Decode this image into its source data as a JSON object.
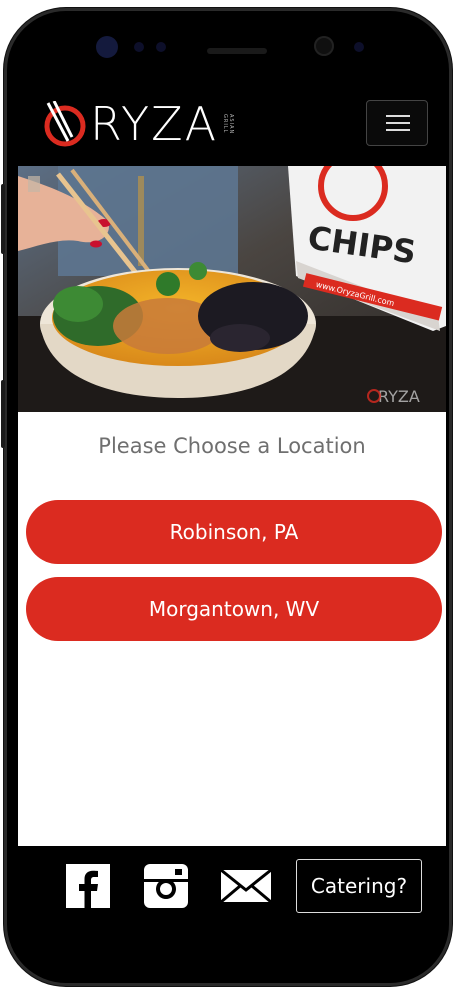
{
  "brand": {
    "name": "RYZA",
    "tagline": "ASIAN GRILL"
  },
  "hero": {
    "bag_text": "CHIPS",
    "bag_url": "www.OryzaGrill.com",
    "watermark": "RYZA"
  },
  "page": {
    "subtitle": "Please Choose a Location"
  },
  "locations": [
    {
      "label": "Robinson, PA"
    },
    {
      "label": "Morgantown, WV"
    }
  ],
  "footer": {
    "icons": [
      "facebook-icon",
      "instagram-icon",
      "mail-icon"
    ],
    "catering_label": "Catering?"
  },
  "colors": {
    "accent": "#db2b20",
    "bar": "#000000",
    "subtitle": "#6f6f6f"
  }
}
